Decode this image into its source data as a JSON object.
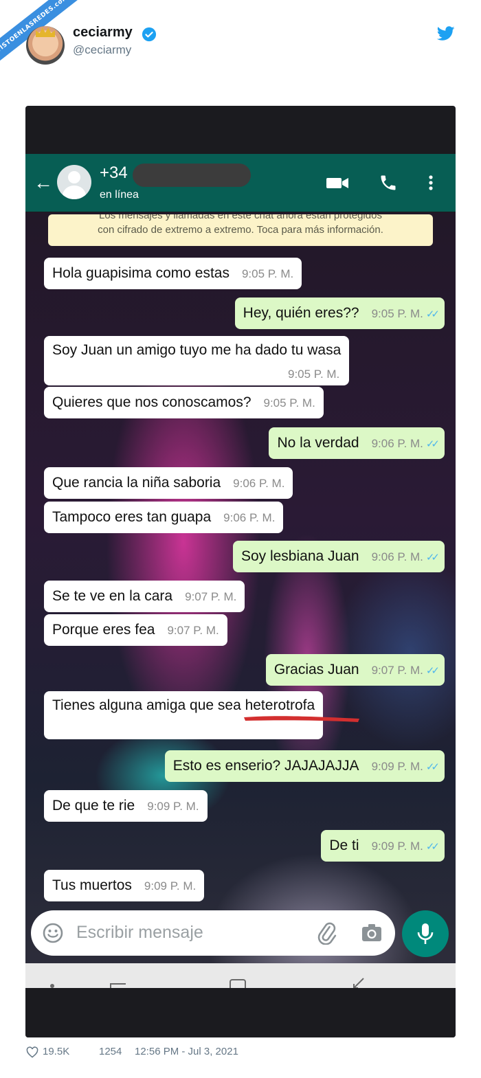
{
  "watermark": "VISTOENLASREDES.com",
  "tweet": {
    "username": "ceciarmy",
    "handle": "@ceciarmy",
    "likes": "19.5K",
    "comments": "1254",
    "timestamp": "12:56 PM - Jul 3, 2021"
  },
  "whatsapp": {
    "contact": "+34",
    "status": "en línea",
    "encryption_notice_line1": "Los mensajes y llamadas en este chat ahora están protegidos",
    "encryption_notice_line2": "con cifrado de extremo a extremo. Toca para más información.",
    "input_placeholder": "Escribir mensaje",
    "messages": [
      {
        "dir": "in",
        "text": "Hola guapisima como estas",
        "time": "9:05 P. M."
      },
      {
        "dir": "out",
        "text": "Hey, quién eres??",
        "time": "9:05 P. M."
      },
      {
        "dir": "in",
        "text": "Soy Juan un amigo tuyo me ha dado tu wasa",
        "time": "9:05 P. M."
      },
      {
        "dir": "in",
        "text": "Quieres que nos conoscamos?",
        "time": "9:05 P. M."
      },
      {
        "dir": "out",
        "text": "No la verdad",
        "time": "9:06 P. M."
      },
      {
        "dir": "in",
        "text": "Que rancia la niña saboria",
        "time": "9:06 P. M."
      },
      {
        "dir": "in",
        "text": "Tampoco eres tan guapa",
        "time": "9:06 P. M."
      },
      {
        "dir": "out",
        "text": "Soy lesbiana Juan",
        "time": "9:06 P. M."
      },
      {
        "dir": "in",
        "text": "Se te ve en la cara",
        "time": "9:07 P. M."
      },
      {
        "dir": "in",
        "text": "Porque eres fea",
        "time": "9:07 P. M."
      },
      {
        "dir": "out",
        "text": "Gracias Juan",
        "time": "9:07 P. M."
      },
      {
        "dir": "in",
        "text": "Tienes alguna amiga que sea heterotrofa",
        "time": ""
      },
      {
        "dir": "out",
        "text": "Esto es enserio? JAJAJAJJA",
        "time": "9:09 P. M."
      },
      {
        "dir": "in",
        "text": "De que te rie",
        "time": "9:09 P. M."
      },
      {
        "dir": "out",
        "text": "De ti",
        "time": "9:09 P. M."
      },
      {
        "dir": "in",
        "text": "Tus muertos",
        "time": "9:09 P. M."
      }
    ]
  },
  "colors": {
    "wa_header": "#075e54",
    "bubble_out": "#dcf8c6",
    "bubble_in": "#ffffff",
    "read_ticks": "#4fb6ec",
    "twitter_blue": "#1da1f2",
    "mic_button": "#00897b"
  },
  "icons": [
    "verified-icon",
    "twitter-bird-icon",
    "back-arrow-icon",
    "video-call-icon",
    "phone-icon",
    "more-icon",
    "emoji-icon",
    "attach-icon",
    "camera-icon",
    "mic-icon",
    "heart-icon"
  ]
}
